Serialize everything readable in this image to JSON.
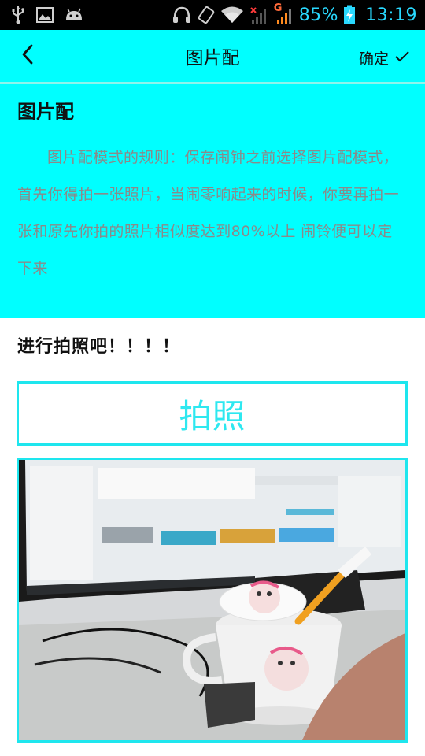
{
  "status_bar": {
    "battery_percent_text": "85%",
    "time": "13:19",
    "network_label": "G",
    "icons": [
      "usb-icon",
      "image-icon",
      "android-icon",
      "headphones-icon",
      "rotate-icon",
      "wifi-icon",
      "signal-off-icon",
      "signal-icon",
      "battery-charging-icon"
    ],
    "accent_color": "#29d9ff"
  },
  "header": {
    "title": "图片配",
    "back_icon": "chevron-left-icon",
    "confirm_label": "确定",
    "confirm_icon": "check-icon",
    "background_color": "#00ffff"
  },
  "description": {
    "heading": "图片配",
    "body": "图片配模式的规则：保存闹钟之前选择图片配模式，首先你得拍一张照片，当闹零响起来的时候，你要再拍一张和原先你拍的照片相似度达到80%以上 闹铃便可以定下来"
  },
  "prompt": {
    "text": "进行拍照吧！！！！"
  },
  "take_photo": {
    "label": "拍照",
    "border_color": "#1ee6ee"
  },
  "photo_preview": {
    "content_icon": "photo-preview-image"
  }
}
